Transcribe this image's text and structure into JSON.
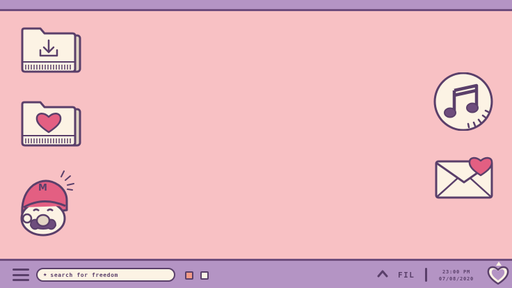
{
  "desktop": {
    "icons": [
      {
        "name": "downloads-folder",
        "icon": "folder-download-icon"
      },
      {
        "name": "favorites-folder",
        "icon": "folder-heart-icon"
      },
      {
        "name": "mario-game",
        "icon": "mario-face-icon"
      },
      {
        "name": "music-app",
        "icon": "music-note-icon"
      },
      {
        "name": "mail-app",
        "icon": "envelope-heart-icon"
      }
    ]
  },
  "colors": {
    "background": "#f8c1c4",
    "bar": "#b494c4",
    "outline": "#5a3f6a",
    "cream": "#fcf3e4",
    "heart": "#e35f82"
  },
  "taskbar": {
    "menu_icon": "hamburger-icon",
    "search": {
      "placeholder": "search for freedom",
      "icon": "star-icon"
    },
    "tray_icon": "chevron-up-icon",
    "language": "FIL",
    "time": "23:00 PM",
    "date": "07/08/2020",
    "notification_icon": "heart-icon"
  }
}
